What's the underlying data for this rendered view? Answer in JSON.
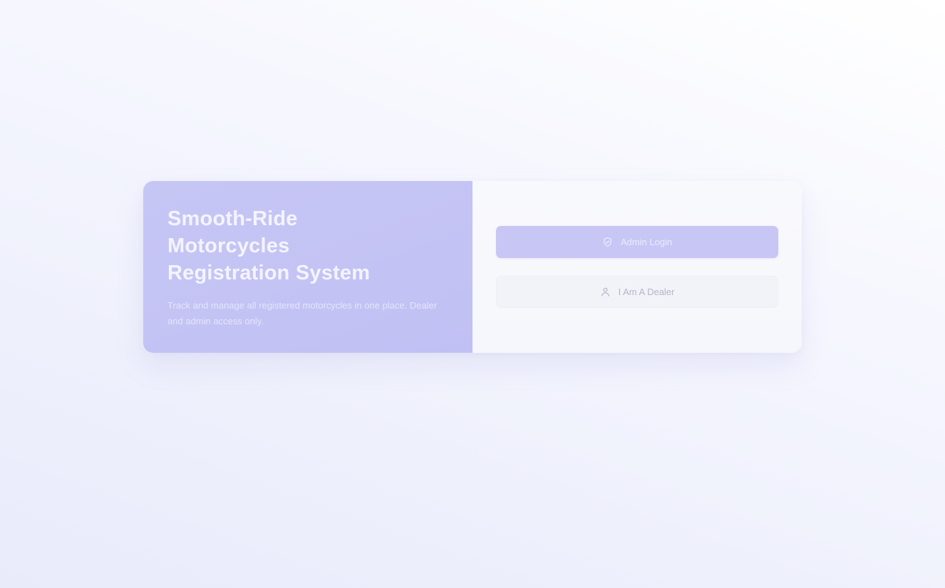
{
  "hero": {
    "title_line_1": "Smooth-Ride",
    "title_line_2": "Motorcycles",
    "title_line_3": "Registration System",
    "description": "Track and manage all registered motorcycles in one place. Dealer and admin access only."
  },
  "actions": {
    "admin_label": "Admin Login",
    "admin_icon": "shield-check-icon",
    "dealer_label": "I Am A Dealer",
    "dealer_icon": "user-icon"
  },
  "colors": {
    "hero_background": "#c4c3f5",
    "admin_button": "#c7c6f5",
    "dealer_button": "#f2f3f9",
    "page_background": "#eef0fc"
  }
}
